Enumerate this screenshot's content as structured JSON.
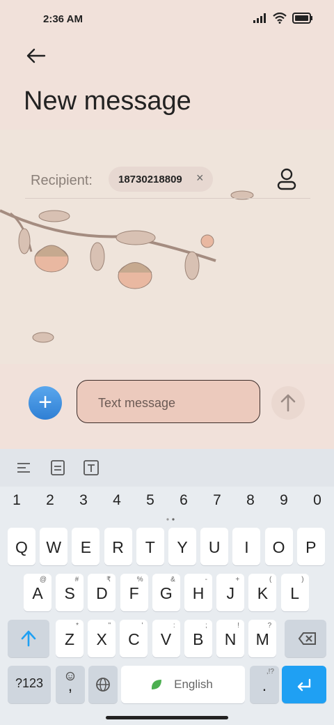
{
  "status": {
    "time": "2:36 AM"
  },
  "header": {
    "title": "New message"
  },
  "recipient": {
    "label": "Recipient:",
    "number": "18730218809",
    "close_glyph": "×"
  },
  "compose": {
    "placeholder": "Text message",
    "add_glyph": "+"
  },
  "keyboard": {
    "numbers": [
      "1",
      "2",
      "3",
      "4",
      "5",
      "6",
      "7",
      "8",
      "9",
      "0"
    ],
    "row1": [
      "Q",
      "W",
      "E",
      "R",
      "T",
      "Y",
      "U",
      "I",
      "O",
      "P"
    ],
    "row2": [
      "A",
      "S",
      "D",
      "F",
      "G",
      "H",
      "J",
      "K",
      "L"
    ],
    "row2_hints": [
      "@",
      "#",
      "₹",
      "%",
      "&",
      "-",
      "+",
      "(",
      ")"
    ],
    "row3": [
      "Z",
      "X",
      "C",
      "V",
      "B",
      "N",
      "M"
    ],
    "row3_hints": [
      "*",
      "\"",
      "'",
      ":",
      ";",
      "!",
      "?"
    ],
    "symbols_label": "?123",
    "comma": ",",
    "space_label": "English",
    "period": ".",
    "period_hint": ",!?"
  },
  "colors": {
    "accent": "#1fa0f3",
    "background": "#f1e1da",
    "input_fill": "#eccabd"
  }
}
